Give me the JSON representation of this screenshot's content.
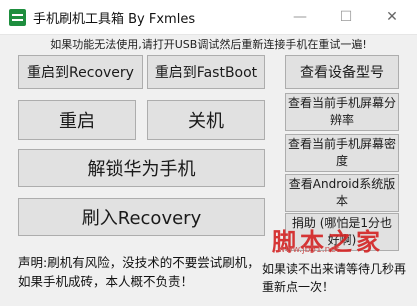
{
  "window": {
    "title": "手机刷机工具箱 By Fxmles",
    "minimize_glyph": "—",
    "maximize_glyph": "☐",
    "close_glyph": "✕",
    "app_icon": "app-icon"
  },
  "notice": "如果功能无法使用,请打开USB调试然后重新连接手机在重试一遍!",
  "buttons": {
    "reboot_recovery": "重启到Recovery",
    "reboot_fastboot": "重启到FastBoot",
    "view_model": "查看设备型号",
    "reboot": "重启",
    "shutdown": "关机",
    "view_resolution": "查看当前手机屏幕分辨率",
    "unlock_huawei": "解锁华为手机",
    "view_density": "查看当前手机屏幕密度",
    "view_android_version": "查看Android系统版本",
    "flash_recovery": "刷入Recovery",
    "donate": "捐助 (哪怕是1分也好啊)"
  },
  "disclaimer": "声明:刷机有风险，没技术的不要尝试刷机，如果手机成砖，本人概不负责！",
  "hint": "如果读不出来请等待几秒再重新点一次！",
  "watermark": {
    "text": "脚本之家",
    "url": "www.jb51.net"
  }
}
